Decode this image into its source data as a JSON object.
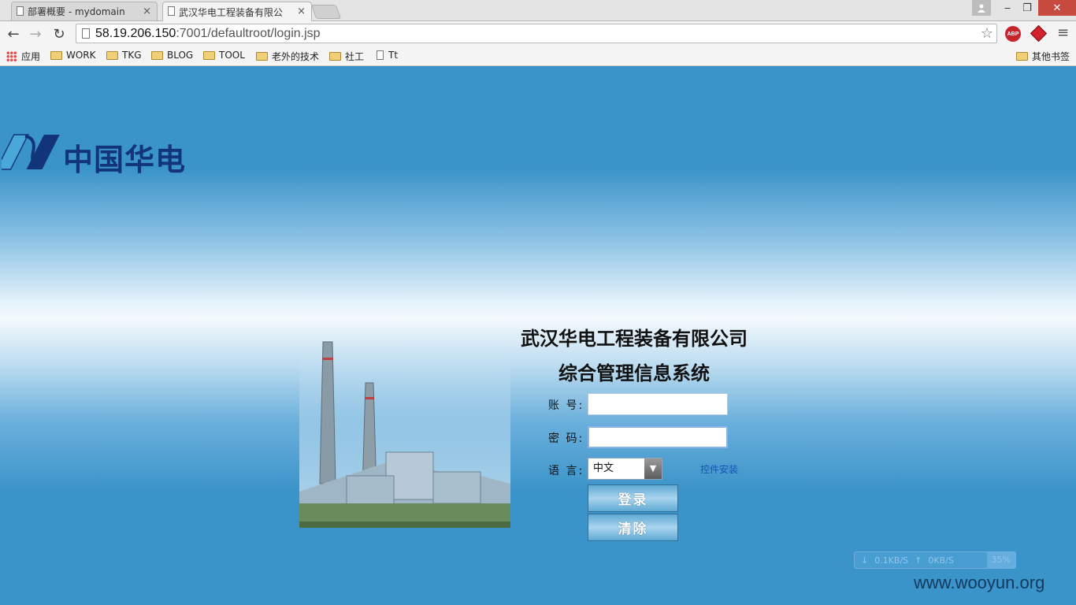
{
  "browser": {
    "tabs": [
      {
        "title": "部署概要 - mydomain - \\",
        "close": "×"
      },
      {
        "title": "武汉华电工程装备有限公司",
        "close": "×"
      }
    ],
    "url_host": "58.19.206.150",
    "url_path": ":7001/defaultroot/login.jsp",
    "abp_label": "ABP",
    "bookmarks": [
      {
        "label": "应用",
        "icon": "apps-icon"
      },
      {
        "label": "WORK",
        "icon": "folder-icon"
      },
      {
        "label": "TKG",
        "icon": "folder-icon"
      },
      {
        "label": "BLOG",
        "icon": "folder-icon"
      },
      {
        "label": "TOOL",
        "icon": "folder-icon"
      },
      {
        "label": "老外的技术",
        "icon": "folder-icon"
      },
      {
        "label": "社工",
        "icon": "folder-icon"
      },
      {
        "label": "Tt",
        "icon": "file-icon"
      }
    ],
    "other_bookmarks": "其他书签"
  },
  "page": {
    "logo_text": "中国华电",
    "title_line1": "武汉华电工程装备有限公司",
    "title_line2": "综合管理信息系统",
    "account_label": "账 号:",
    "password_label": "密 码:",
    "language_label": "语 言:",
    "account_value": "",
    "password_value": "",
    "language_selected": "中文",
    "install_link": "控件安装",
    "login_button": "登录",
    "clear_button": "清除"
  },
  "overlay": {
    "down_speed": "0.1KB/S",
    "up_speed": "0KB/S",
    "percent": "35%",
    "watermark": "www.wooyun.org"
  }
}
